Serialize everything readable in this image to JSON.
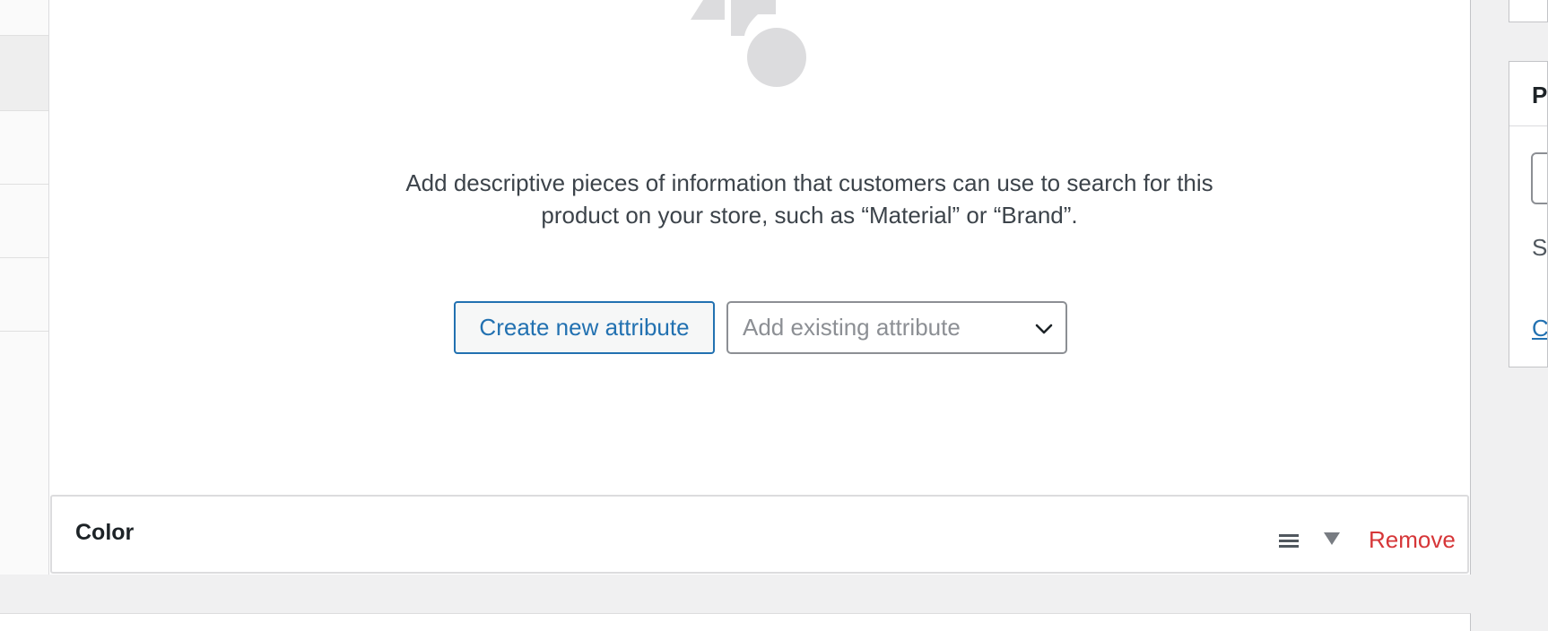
{
  "attributes_panel": {
    "empty_message_line1": "Add descriptive pieces of information that customers can use to search for this",
    "empty_message_line2": "product on your store, such as “Material” or “Brand”.",
    "create_button_label": "Create new attribute",
    "existing_select_placeholder": "Add existing attribute",
    "illustration_icon": "shapes-illustration"
  },
  "attribute_rows": [
    {
      "name": "Color",
      "remove_label": "Remove",
      "drag_icon": "hamburger-icon",
      "toggle_icon": "caret-down-icon"
    }
  ],
  "sidebar": {
    "box_title_fragment": "P",
    "text_fragment": "S",
    "link_fragment": "C"
  },
  "colors": {
    "accent": "#2271b1",
    "danger": "#d63638",
    "icon_gray": "#dcdcde",
    "text": "#3c434a"
  }
}
